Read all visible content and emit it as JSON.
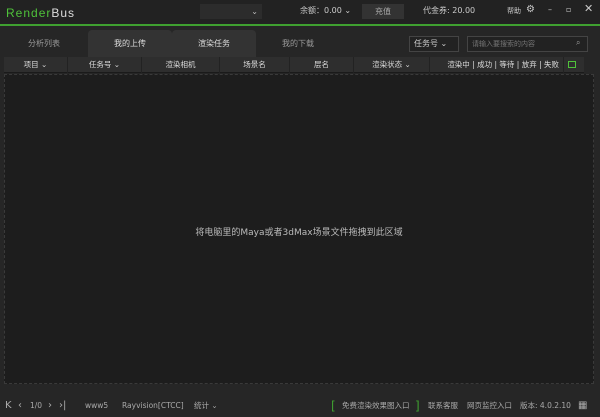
{
  "app": {
    "logo_prefix": "Render",
    "logo_suffix": "Bus",
    "user_dropdown": "⌄"
  },
  "header": {
    "balance_label": "余额：0.00",
    "recharge": "充值",
    "voucher": "代金券: 20.00",
    "help": "帮助"
  },
  "tabs": [
    {
      "label": "分析列表"
    },
    {
      "label": "我的上传"
    },
    {
      "label": "渲染任务"
    },
    {
      "label": "我的下载"
    }
  ],
  "filter": {
    "selected": "任务号"
  },
  "search": {
    "placeholder": "请输入要搜索的内容"
  },
  "table": {
    "columns": [
      "项目",
      "任务号",
      "渲染相机",
      "场景名",
      "层名",
      "渲染状态",
      "渲染中 | 成功 | 等待 | 放弃 | 失败"
    ]
  },
  "drop_hint": "将电脑里的Maya或者3dMax场景文件拖拽到此区域",
  "footer": {
    "page": "1/0",
    "user": "www5",
    "server": "Rayvision[CTCC]",
    "stats": "统计",
    "free_entry": "免费渲染效果图入口",
    "support": "联系客服",
    "web_monitor": "网页监控入口",
    "version": "版本: 4.0.2.10"
  },
  "colors": {
    "accent": "#3fa030"
  }
}
